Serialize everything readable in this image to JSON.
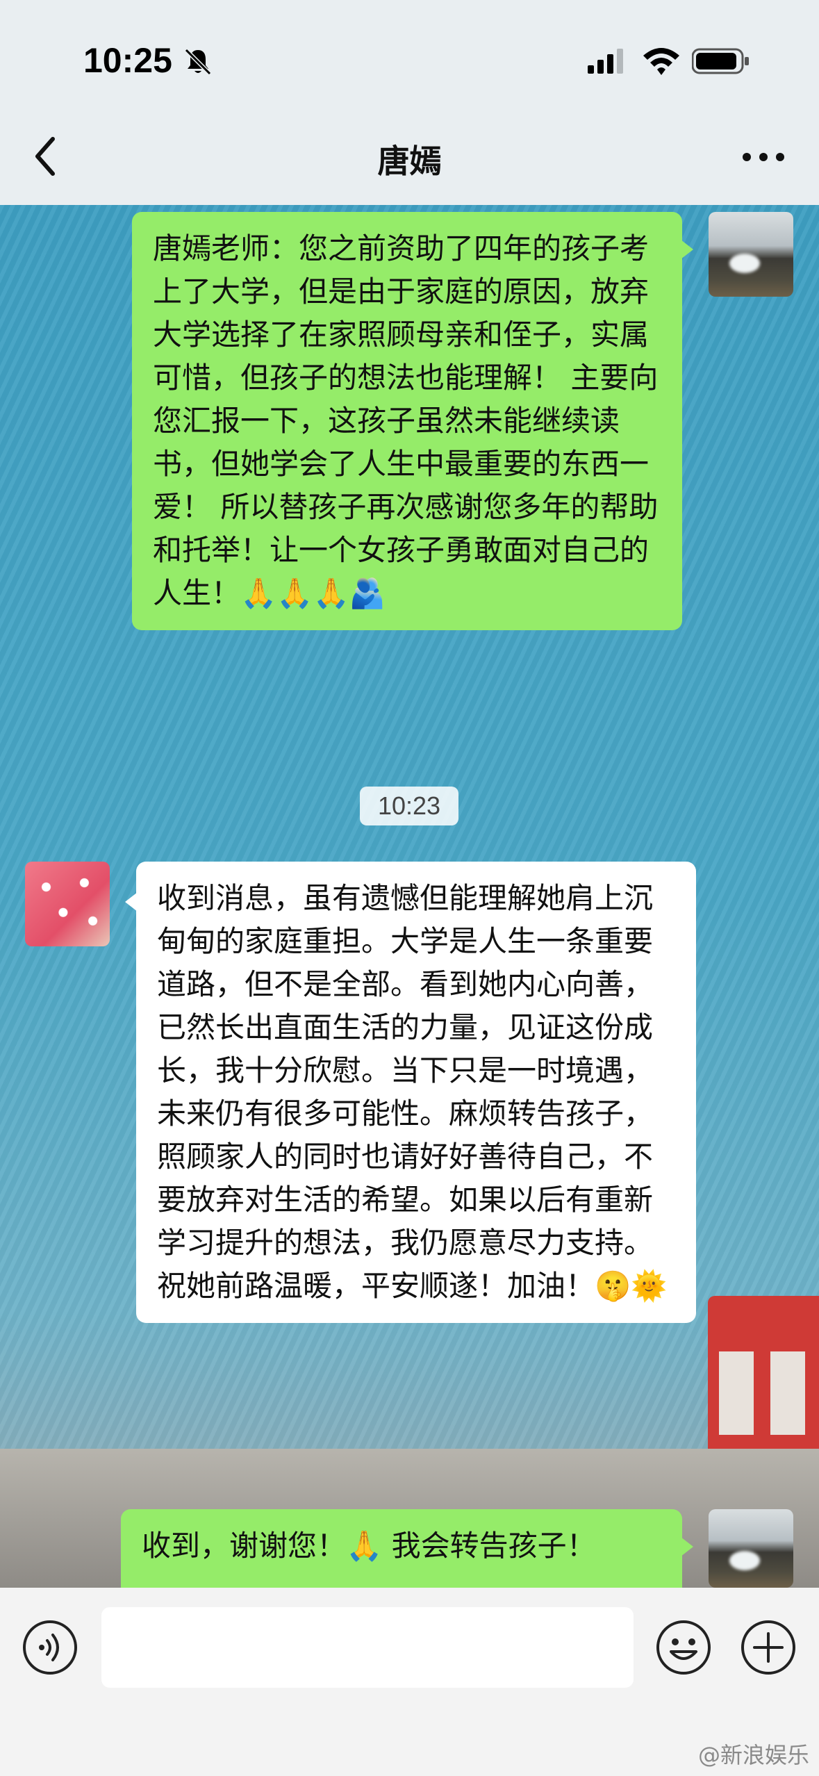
{
  "status_bar": {
    "time": "10:25"
  },
  "nav": {
    "title": "唐嫣"
  },
  "messages": [
    {
      "side": "me",
      "text": "唐嫣老师：您之前资助了四年的孩子考上了大学，但是由于家庭的原因，放弃大学选择了在家照顾母亲和侄子，实属可惜，但孩子的想法也能理解！ 主要向您汇报一下，这孩子虽然未能继续读书，但她学会了人生中最重要的东西一爱！ 所以替孩子再次感谢您多年的帮助和托举！让一个女孩子勇敢面对自己的人生！🙏🙏🙏🫂"
    },
    {
      "type": "timestamp",
      "text": "10:23"
    },
    {
      "side": "them",
      "text": "收到消息，虽有遗憾但能理解她肩上沉甸甸的家庭重担。大学是人生一条重要道路，但不是全部。看到她内心向善，已然长出直面生活的力量，见证这份成长，我十分欣慰。当下只是一时境遇，未来仍有很多可能性。麻烦转告孩子，照顾家人的同时也请好好善待自己，不要放弃对生活的希望。如果以后有重新学习提升的想法，我仍愿意尽力支持。祝她前路温暖，平安顺遂！加油！🤫🌞"
    },
    {
      "side": "me",
      "text": "收到，谢谢您！🙏 我会转告孩子！"
    }
  ],
  "input": {
    "placeholder": ""
  },
  "watermark": "@新浪娱乐",
  "icons": {
    "back": "chevron-left-icon",
    "more": "more-horizontal-icon",
    "voice": "voice-icon",
    "emoji": "emoji-icon",
    "plus": "plus-icon"
  },
  "colors": {
    "my_bubble": "#95ec69",
    "their_bubble": "#ffffff",
    "topbar": "#e9eef1"
  }
}
